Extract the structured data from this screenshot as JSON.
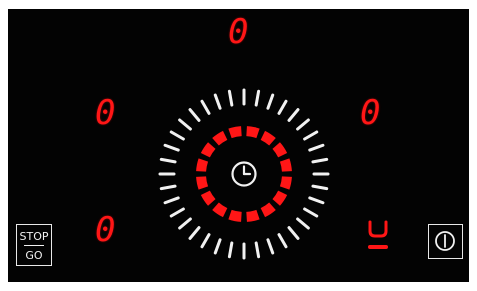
{
  "cooktop": {
    "zones": {
      "top": "0",
      "left_upper": "0",
      "right_upper": "0",
      "left_lower": "0"
    },
    "controls": {
      "stop_label": "STOP",
      "go_label": "GO"
    },
    "icons": {
      "timer": "clock-icon",
      "power": "power-icon",
      "indicator": "heat-indicator-icon"
    },
    "colors": {
      "active": "#ff1616",
      "inactive": "#f1f1f1",
      "background": "#030303"
    }
  }
}
